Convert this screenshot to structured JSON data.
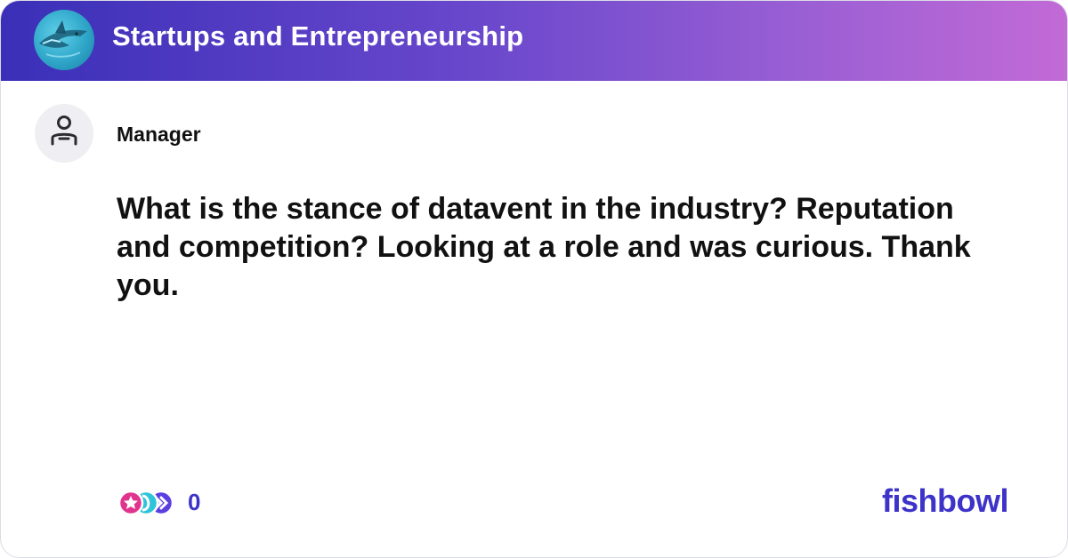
{
  "header": {
    "bowl_title": "Startups and Entrepreneurship",
    "bowl_logo_icon": "shark-icon"
  },
  "post": {
    "author": "Manager",
    "avatar_icon": "user-icon",
    "text": "What is the stance of datavent in the industry? Reputation and competition? Looking at a role and was curious. Thank you.",
    "reaction_count": "0",
    "reaction_icons": [
      "heart-reaction-icon",
      "star-reaction-icon",
      "clap-reaction-icon"
    ]
  },
  "footer": {
    "brand": "fishbowl"
  },
  "colors": {
    "header_gradient_start": "#3a2fb8",
    "header_gradient_end": "#c26ad6",
    "brand": "#3d33c9"
  }
}
